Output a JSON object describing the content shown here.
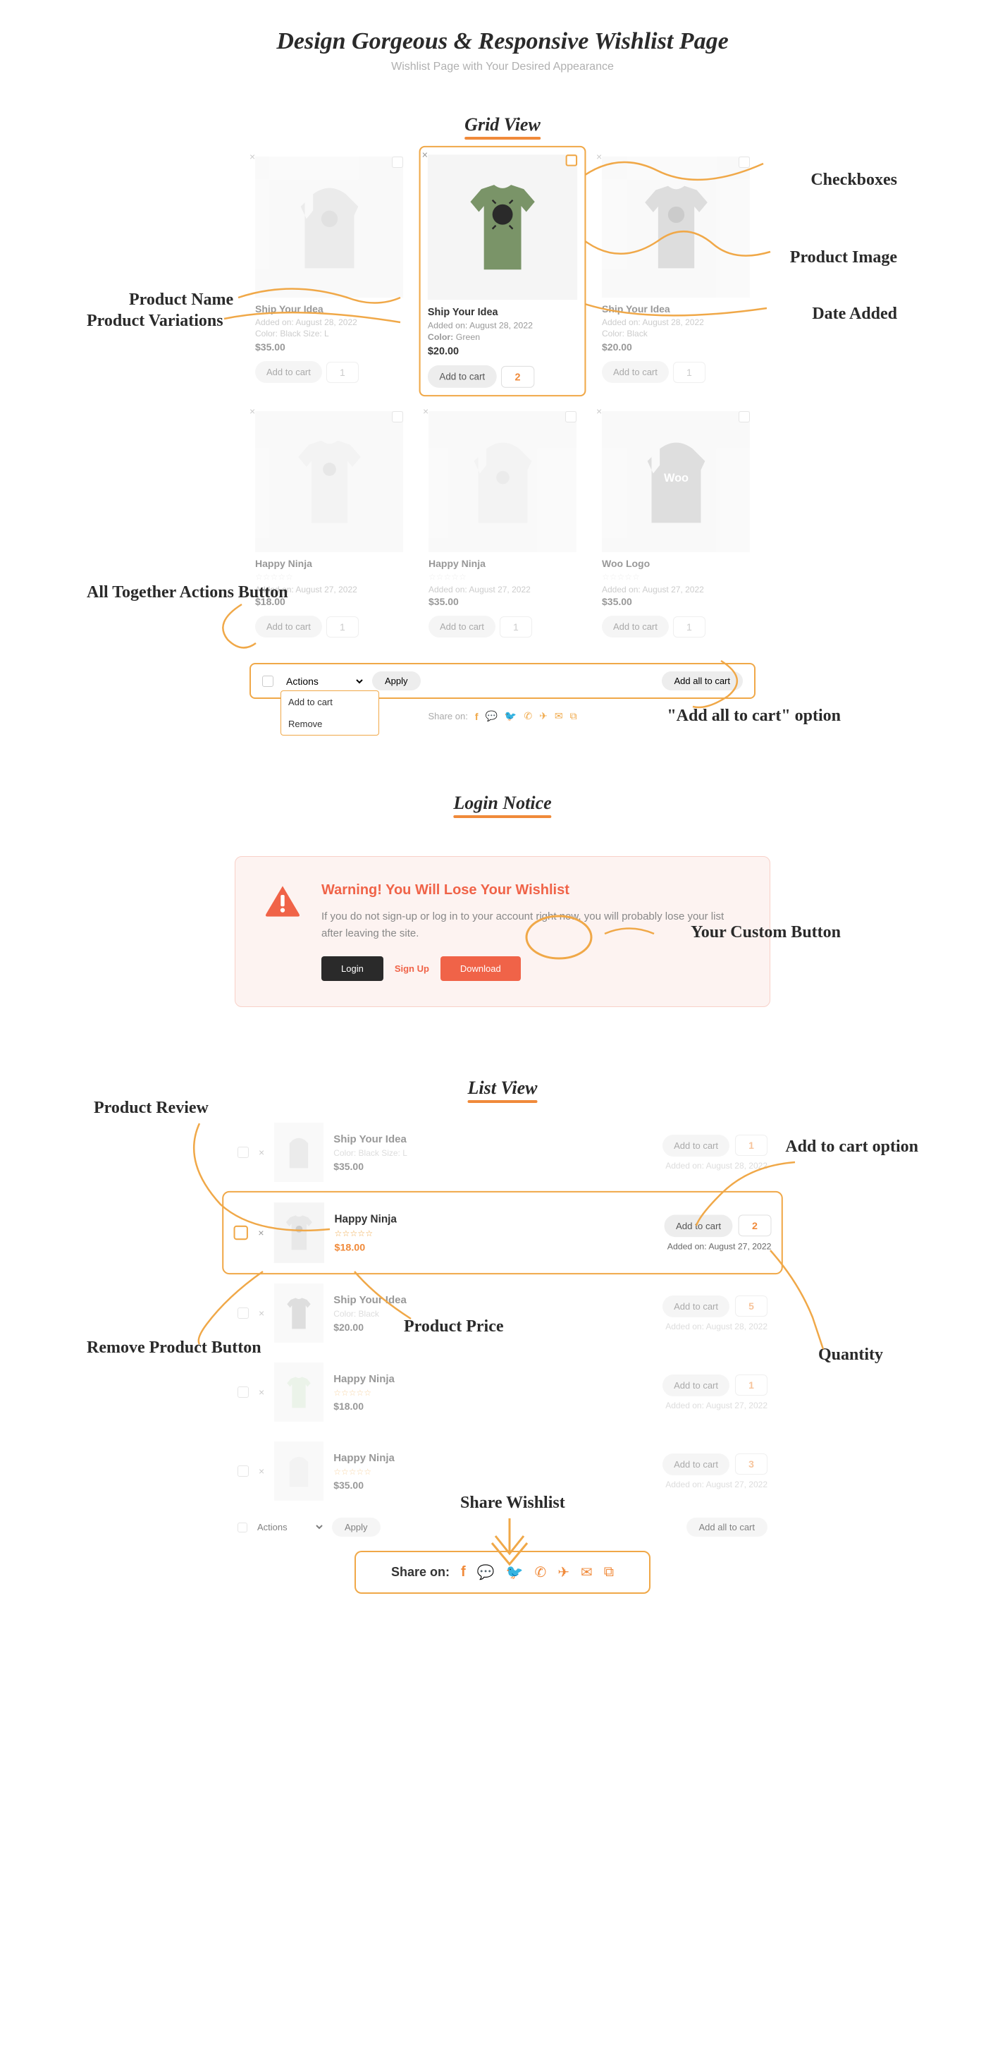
{
  "header": {
    "title": "Design Gorgeous & Responsive Wishlist Page",
    "subtitle": "Wishlist Page with Your Desired Appearance"
  },
  "sections": {
    "grid": "Grid View",
    "login": "Login Notice",
    "list": "List View"
  },
  "annotations": {
    "checkboxes": "Checkboxes",
    "product_image": "Product Image",
    "product_name": "Product Name",
    "product_variations": "Product Variations",
    "date_added": "Date Added",
    "all_together": "All Together Actions Button",
    "add_all_option": "\"Add all to cart\" option",
    "your_custom_button": "Your Custom Button",
    "product_review": "Product Review",
    "add_to_cart_option": "Add to cart option",
    "remove_product": "Remove Product Button",
    "product_price": "Product Price",
    "quantity": "Quantity",
    "share_wishlist": "Share Wishlist"
  },
  "buttons": {
    "add_to_cart": "Add to cart",
    "apply": "Apply",
    "add_all_to_cart": "Add all to cart",
    "login": "Login",
    "signup": "Sign Up",
    "download": "Download",
    "actions": "Actions"
  },
  "bulk_dropdown": {
    "opt1": "Add to cart",
    "opt2": "Remove"
  },
  "share_label": "Share on:",
  "login_notice": {
    "heading": "Warning! You Will Lose Your Wishlist",
    "body": "If you do not sign-up or log in to your account right now, you will probably lose your list after leaving the site."
  },
  "grid_products": [
    {
      "name": "Ship Your Idea",
      "added": "Added on: August 28, 2022",
      "variation": "Color: Black   Size: L",
      "price": "$35.00",
      "qty": "1"
    },
    {
      "name": "Ship Your Idea",
      "added": "Added on: August 28, 2022",
      "variation": "Color: Green",
      "price": "$20.00",
      "qty": "2"
    },
    {
      "name": "Ship Your Idea",
      "added": "Added on: August 28, 2022",
      "variation": "Color: Black",
      "price": "$20.00",
      "qty": "1"
    },
    {
      "name": "Happy Ninja",
      "added": "Added on: August 27, 2022",
      "variation": "",
      "price": "$18.00",
      "qty": "1"
    },
    {
      "name": "Happy Ninja",
      "added": "Added on: August 27, 2022",
      "variation": "",
      "price": "$35.00",
      "qty": "1"
    },
    {
      "name": "Woo Logo",
      "added": "Added on: August 27, 2022",
      "variation": "",
      "price": "$35.00",
      "qty": "1"
    }
  ],
  "list_products": [
    {
      "name": "Ship Your Idea",
      "detail": "Color: Black   Size: L",
      "price": "$35.00",
      "added": "Added on: August 28, 2022",
      "qty": "1"
    },
    {
      "name": "Happy Ninja",
      "detail": "stars",
      "price": "$18.00",
      "added": "Added on: August 27, 2022",
      "qty": "2"
    },
    {
      "name": "Ship Your Idea",
      "detail": "Color: Black",
      "price": "$20.00",
      "added": "Added on: August 28, 2022",
      "qty": "5"
    },
    {
      "name": "Happy Ninja",
      "detail": "stars",
      "price": "$18.00",
      "added": "Added on: August 27, 2022",
      "qty": "1"
    },
    {
      "name": "Happy Ninja",
      "detail": "stars",
      "price": "$35.00",
      "added": "Added on: August 27, 2022",
      "qty": "3"
    }
  ]
}
